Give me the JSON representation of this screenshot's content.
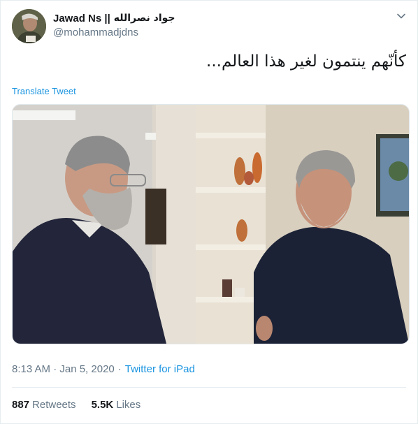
{
  "user": {
    "display_name": "Jawad Ns ||",
    "display_name_ar": "جواد نصرالله",
    "handle": "@mohammadjdns"
  },
  "tweet": {
    "text": "كأنّهم ينتمون لغير هذا العالم...",
    "translate_label": "Translate Tweet"
  },
  "meta": {
    "time": "8:13 AM · Jan 5, 2020",
    "separator": "·",
    "source": "Twitter for iPad"
  },
  "stats": {
    "retweets_count": "887",
    "retweets_label": "Retweets",
    "likes_count": "5.5K",
    "likes_label": "Likes"
  },
  "icons": {
    "menu": "chevron-down-icon"
  },
  "colors": {
    "link": "#1b95e0",
    "muted": "#657786",
    "text": "#14171a"
  }
}
